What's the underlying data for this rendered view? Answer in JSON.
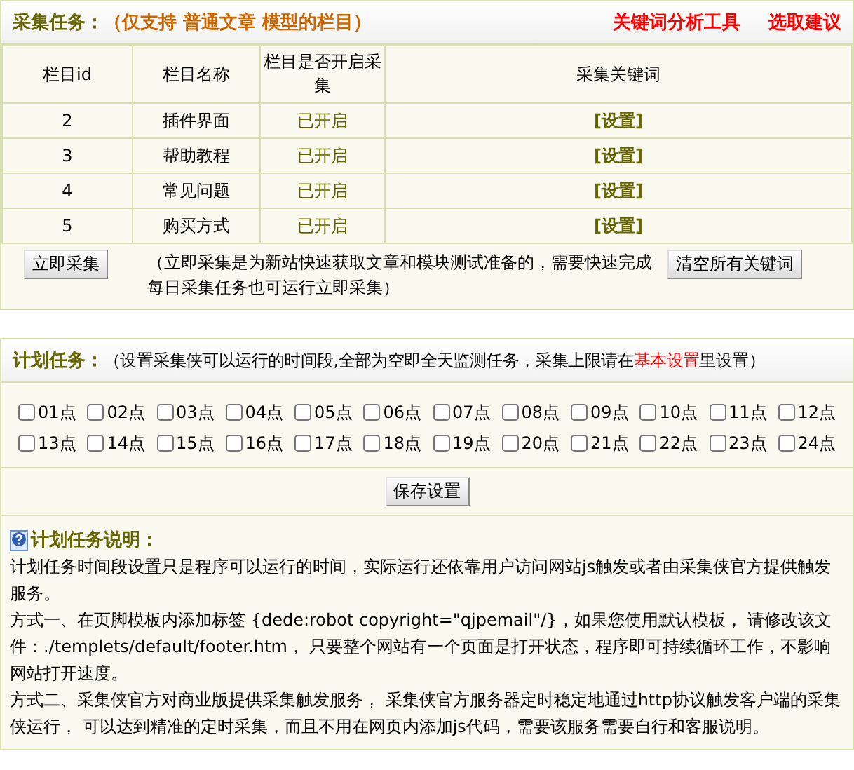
{
  "task_panel": {
    "title": "采集任务：",
    "subtitle": "（仅支持 普通文章 模型的栏目）",
    "links": [
      "关键词分析工具",
      "选取建议"
    ],
    "table": {
      "columns": [
        "栏目id",
        "栏目名称",
        "栏目是否开启采集",
        "采集关键词"
      ],
      "rows": [
        {
          "id": "2",
          "name": "插件界面",
          "status": "已开启",
          "action": "[设置]"
        },
        {
          "id": "3",
          "name": "帮助教程",
          "status": "已开启",
          "action": "[设置]"
        },
        {
          "id": "4",
          "name": "常见问题",
          "status": "已开启",
          "action": "[设置]"
        },
        {
          "id": "5",
          "name": "购买方式",
          "status": "已开启",
          "action": "[设置]"
        }
      ]
    },
    "collect_button": "立即采集",
    "collect_note": "（立即采集是为新站快速获取文章和模块测试准备的，需要快速完成每日采集任务也可运行立即采集）",
    "clear_button": "清空所有关键词"
  },
  "schedule_panel": {
    "title": "计划任务：",
    "hint_before": "（设置采集侠可以运行的时间段,全部为空即全天监测任务，采集上限请在",
    "hint_link": "基本设置",
    "hint_after": "里设置）",
    "hours": [
      {
        "label": "01点",
        "checked": false
      },
      {
        "label": "02点",
        "checked": false
      },
      {
        "label": "03点",
        "checked": false
      },
      {
        "label": "04点",
        "checked": false
      },
      {
        "label": "05点",
        "checked": false
      },
      {
        "label": "06点",
        "checked": false
      },
      {
        "label": "07点",
        "checked": false
      },
      {
        "label": "08点",
        "checked": false
      },
      {
        "label": "09点",
        "checked": false
      },
      {
        "label": "10点",
        "checked": false
      },
      {
        "label": "11点",
        "checked": false
      },
      {
        "label": "12点",
        "checked": false
      },
      {
        "label": "13点",
        "checked": false
      },
      {
        "label": "14点",
        "checked": false
      },
      {
        "label": "15点",
        "checked": false
      },
      {
        "label": "16点",
        "checked": false
      },
      {
        "label": "17点",
        "checked": false
      },
      {
        "label": "18点",
        "checked": false
      },
      {
        "label": "19点",
        "checked": false
      },
      {
        "label": "20点",
        "checked": false
      },
      {
        "label": "21点",
        "checked": false
      },
      {
        "label": "22点",
        "checked": false
      },
      {
        "label": "23点",
        "checked": false
      },
      {
        "label": "24点",
        "checked": false
      }
    ],
    "save_button": "保存设置",
    "notes_title": "计划任务说明：",
    "notes": [
      "计划任务时间段设置只是程序可以运行的时间，实际运行还依靠用户访问网站js触发或者由采集侠官方提供触发服务。",
      "方式一、在页脚模板内添加标签 {dede:robot copyright=\"qjpemail\"/}，如果您使用默认模板， 请修改该文件：./templets/default/footer.htm， 只要整个网站有一个页面是打开状态，程序即可持续循环工作，不影响网站打开速度。",
      "方式二、采集侠官方对商业版提供采集触发服务， 采集侠官方服务器定时稳定地通过http协议触发客户端的采集侠运行， 可以达到精准的定时采集，而且不用在网页内添加js代码，需要该服务需要自行和客服说明。"
    ]
  }
}
